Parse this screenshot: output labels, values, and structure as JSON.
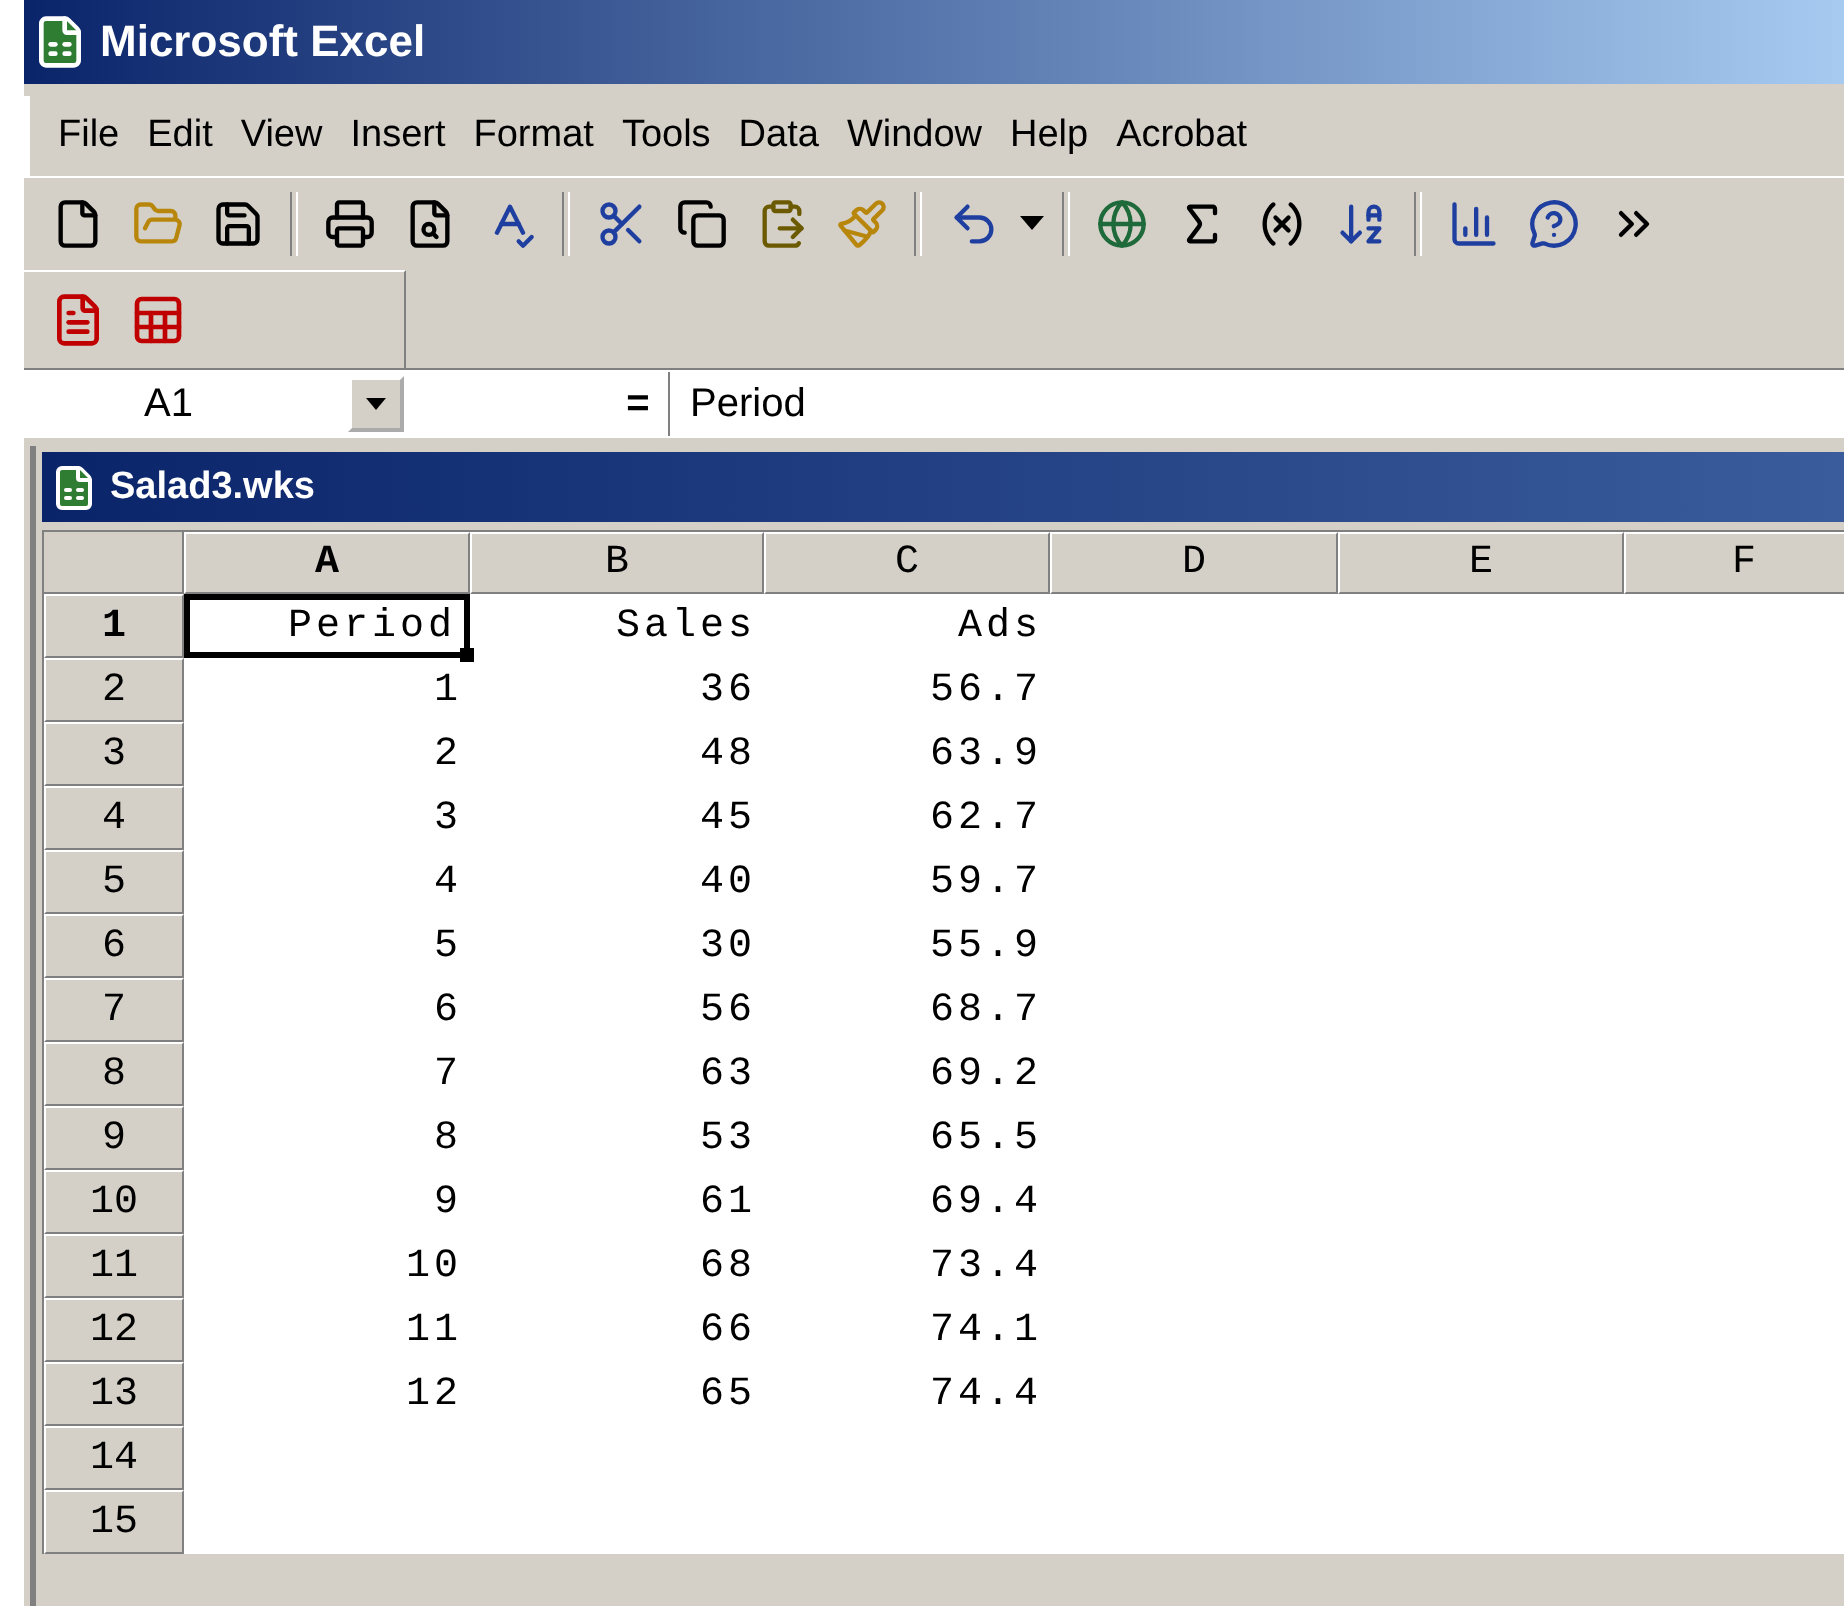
{
  "window": {
    "title": "Microsoft Excel"
  },
  "menu": [
    {
      "label": "File"
    },
    {
      "label": "Edit"
    },
    {
      "label": "View"
    },
    {
      "label": "Insert"
    },
    {
      "label": "Format"
    },
    {
      "label": "Tools"
    },
    {
      "label": "Data"
    },
    {
      "label": "Window"
    },
    {
      "label": "Help"
    },
    {
      "label": "Acrobat"
    }
  ],
  "formula_bar": {
    "name_box": "A1",
    "equals": "=",
    "value": "Period"
  },
  "workbook": {
    "title": "Salad3.wks",
    "columns": [
      {
        "label": "A",
        "selected": true
      },
      {
        "label": "B",
        "selected": false
      },
      {
        "label": "C",
        "selected": false
      },
      {
        "label": "D",
        "selected": false
      },
      {
        "label": "E",
        "selected": false
      },
      {
        "label": "F",
        "selected": false
      }
    ],
    "rows": [
      {
        "header": "1",
        "selected": true,
        "cells": [
          "Period",
          "Sales",
          "Ads"
        ]
      },
      {
        "header": "2",
        "selected": false,
        "cells": [
          "1",
          "36",
          "56.7"
        ]
      },
      {
        "header": "3",
        "selected": false,
        "cells": [
          "2",
          "48",
          "63.9"
        ]
      },
      {
        "header": "4",
        "selected": false,
        "cells": [
          "3",
          "45",
          "62.7"
        ]
      },
      {
        "header": "5",
        "selected": false,
        "cells": [
          "4",
          "40",
          "59.7"
        ]
      },
      {
        "header": "6",
        "selected": false,
        "cells": [
          "5",
          "30",
          "55.9"
        ]
      },
      {
        "header": "7",
        "selected": false,
        "cells": [
          "6",
          "56",
          "68.7"
        ]
      },
      {
        "header": "8",
        "selected": false,
        "cells": [
          "7",
          "63",
          "69.2"
        ]
      },
      {
        "header": "9",
        "selected": false,
        "cells": [
          "8",
          "53",
          "65.5"
        ]
      },
      {
        "header": "10",
        "selected": false,
        "cells": [
          "9",
          "61",
          "69.4"
        ]
      },
      {
        "header": "11",
        "selected": false,
        "cells": [
          "10",
          "68",
          "73.4"
        ]
      },
      {
        "header": "12",
        "selected": false,
        "cells": [
          "11",
          "66",
          "74.1"
        ]
      },
      {
        "header": "13",
        "selected": false,
        "cells": [
          "12",
          "65",
          "74.4"
        ]
      },
      {
        "header": "14",
        "selected": false,
        "cells": []
      },
      {
        "header": "15",
        "selected": false,
        "cells": []
      }
    ]
  }
}
